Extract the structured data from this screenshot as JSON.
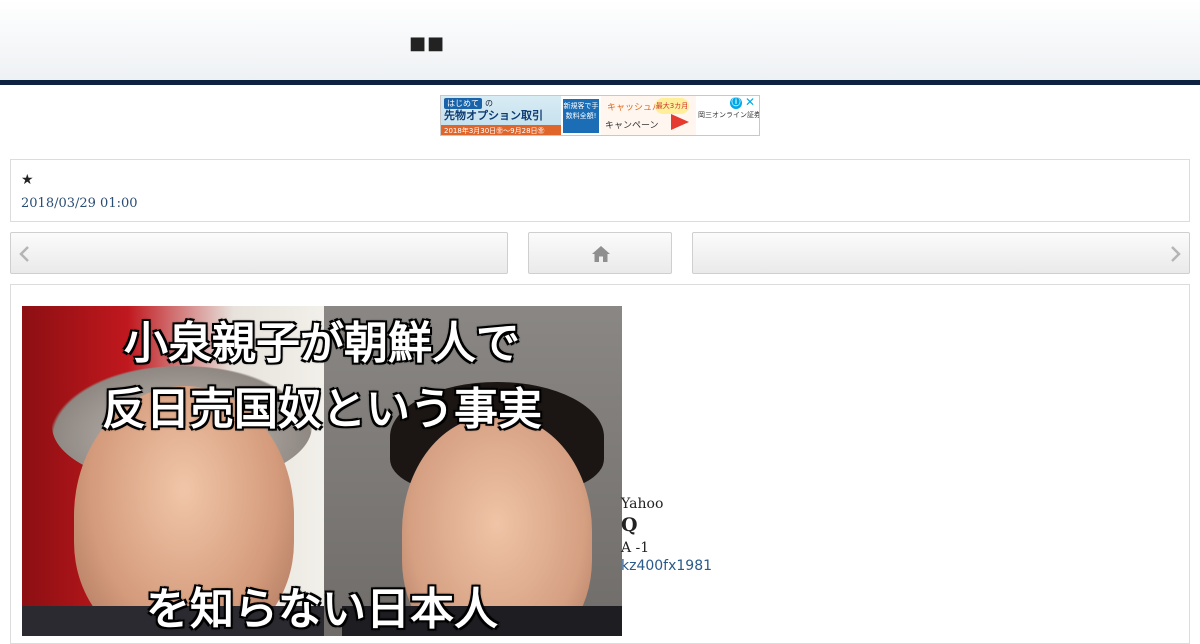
{
  "header": {
    "logo_text": "■■"
  },
  "ad": {
    "tag": "はじめて",
    "tag_suffix": "の",
    "headline": "先物オプション取引",
    "period": "2018年3月30日㊎～9月28日㊎",
    "blue_box": "新規客で手数料全額!",
    "mid_top": "キャッシュバック",
    "mid_bottom": "キャンペーン",
    "badge": "最大3カ月",
    "company": "岡三オンライン証券",
    "info_icon": "ⓘ",
    "close_icon": "✕"
  },
  "post": {
    "title": "★",
    "date": "2018/03/29 01:00"
  },
  "nav": {
    "prev_icon": "chevron-left-icon",
    "home_icon": "home-icon",
    "next_icon": "chevron-right-icon"
  },
  "article": {
    "image_caption_line1": "小泉親子が朝鮮人で",
    "image_caption_line2": "反日売国奴という事実",
    "image_caption_line3": "を知らない日本人",
    "source": "Yahoo",
    "question_mark": "Q",
    "answer_line": "A -1",
    "user_id": "kz400fx1981"
  },
  "colors": {
    "header_rule": "#0d2240",
    "date_text": "#2a4d74",
    "link": "#2a5a8a"
  }
}
